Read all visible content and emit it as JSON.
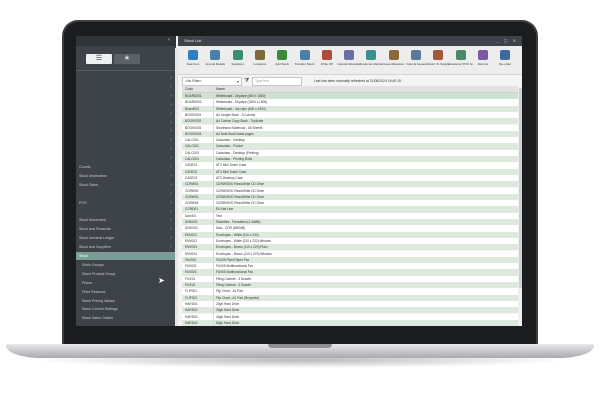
{
  "window": {
    "title": "Stock List",
    "controls": "_ ▢ ✕"
  },
  "sidebar": {
    "tabs": [
      {
        "icon": "list-icon"
      },
      {
        "icon": "star-icon"
      }
    ],
    "items": [
      {
        "label": "",
        "sub": false
      },
      {
        "label": "",
        "sub": false
      },
      {
        "label": "",
        "sub": false
      },
      {
        "label": "",
        "sub": false
      },
      {
        "label": "",
        "sub": false
      },
      {
        "label": "",
        "sub": false
      },
      {
        "label": "",
        "sub": false
      },
      {
        "label": "",
        "sub": false
      },
      {
        "label": "",
        "sub": false
      },
      {
        "label": "",
        "sub": false
      },
      {
        "label": "Counts",
        "sub": false
      },
      {
        "label": "Stock Information",
        "sub": false
      },
      {
        "label": "Stock Sales",
        "sub": false
      },
      {
        "label": "",
        "sub": false
      },
      {
        "label": "POS",
        "sub": false
      },
      {
        "label": "",
        "sub": false
      },
      {
        "label": "Stock Movement",
        "sub": false
      },
      {
        "label": "Stock and Financial",
        "sub": false
      },
      {
        "label": "Stock Nominal Ledger",
        "sub": false
      },
      {
        "label": "Stock and Suppliers",
        "sub": false
      },
      {
        "label": "Stock",
        "sub": false,
        "active": true
      },
      {
        "label": "Stock Groups",
        "sub": true
      },
      {
        "label": "Stock Product Group",
        "sub": true
      },
      {
        "label": "Prices",
        "sub": true
      },
      {
        "label": "Price Reasons",
        "sub": true
      },
      {
        "label": "Stock Pricing Values",
        "sub": true
      },
      {
        "label": "Stock Control Settings",
        "sub": true
      },
      {
        "label": "Stock Sales Orders",
        "sub": true
      }
    ]
  },
  "toolbar": {
    "buttons": [
      {
        "label": "New Item",
        "icon": "new-item-icon",
        "color": "#2d7fc1"
      },
      {
        "label": "Amend Details",
        "icon": "amend-icon",
        "color": "#4a7fa8"
      },
      {
        "label": "Suppliers",
        "icon": "suppliers-icon",
        "color": "#3a8f6d"
      },
      {
        "label": "Locations",
        "icon": "locations-icon",
        "color": "#7a6a3a"
      },
      {
        "label": "Add Stock",
        "icon": "add-stock-icon",
        "color": "#3c8a3c"
      },
      {
        "label": "Transfer Stock",
        "icon": "transfer-icon",
        "color": "#4a7fa8"
      },
      {
        "label": "Write Off",
        "icon": "write-off-icon",
        "color": "#b04a3a"
      },
      {
        "label": "Internal Allocation",
        "icon": "allocation-icon",
        "color": "#6b6fa8"
      },
      {
        "label": "Customer Allocation",
        "icon": "customer-allocation-icon",
        "color": "#3a8f8f"
      },
      {
        "label": "Issue Allocation",
        "icon": "issue-allocation-icon",
        "color": "#8a6a3a"
      },
      {
        "label": "Internal Issues",
        "icon": "internal-issues-icon",
        "color": "#5a7a9a"
      },
      {
        "label": "Return To Supplier",
        "icon": "return-icon",
        "color": "#a05a3a"
      },
      {
        "label": "Customer POO Issues",
        "icon": "poo-issues-icon",
        "color": "#4a8a6a"
      },
      {
        "label": "Returns",
        "icon": "returns-icon",
        "color": "#7a5aa0"
      },
      {
        "label": "Re-order",
        "icon": "reorder-icon",
        "color": "#3a6aa0"
      }
    ]
  },
  "filter": {
    "selected": "<No Filter>",
    "search_placeholder": "Type text",
    "refresh_text": "Last has been manually refreshed at 21/08/2024 16:40:15"
  },
  "table": {
    "columns": [
      "Code",
      "Name"
    ],
    "rows": [
      {
        "code": "BOARD001",
        "name": "Whiteboard - Drywipe (600 x 1800)"
      },
      {
        "code": "BOARD002",
        "name": "Whiteboard - Drywipe (1500 x 1800)"
      },
      {
        "code": "Board003",
        "name": "Whiteboard - dry wipe (600 x 1500)"
      },
      {
        "code": "BOOK0001",
        "name": "A4 Ledger Book - 5 Column"
      },
      {
        "code": "BOOK0002",
        "name": "A4 Carbon Copy Book - Triplicate"
      },
      {
        "code": "BOOK0003",
        "name": "Shorthand Notebook - 80 Sheets"
      },
      {
        "code": "BOOK0004",
        "name": "A4 Note Book blank pages"
      },
      {
        "code": "CALC001",
        "name": "Calculator - Desktop"
      },
      {
        "code": "CALC002",
        "name": "Calculator - Pocket"
      },
      {
        "code": "CALC003",
        "name": "Calculator - Desktop (Printing)"
      },
      {
        "code": "CALC004",
        "name": "Calculator - Printing Rolls"
      },
      {
        "code": "CASE01",
        "name": "ATX Mini Tower Case"
      },
      {
        "code": "CASE02",
        "name": "ATX Mini Tower Case"
      },
      {
        "code": "CASE03",
        "name": "ATX Desktop Case"
      },
      {
        "code": "CDRW01",
        "name": "CDRW/DVD Read/Write CD Drive"
      },
      {
        "code": "CDRW02",
        "name": "CDRW/DVD Read/Write CD Drive"
      },
      {
        "code": "CDRW03",
        "name": "CDRW/DVD Read/Write CD Drive"
      },
      {
        "code": "CDRW04",
        "name": "CDRW/DVD Read/Write CD Drive"
      },
      {
        "code": "CORD01",
        "name": "EU Net Line"
      },
      {
        "code": "Dan401",
        "name": "Test"
      },
      {
        "code": "DISK001",
        "name": "Diskettes - Formatted (1.44MB)"
      },
      {
        "code": "DISK002",
        "name": "Disk - CDR (650MB)"
      },
      {
        "code": "ENV001",
        "name": "Envelopes - White (110 x 220)"
      },
      {
        "code": "ENV002",
        "name": "Envelopes - White (110 x 220) Window"
      },
      {
        "code": "ENV003",
        "name": "Envelopes - Brown (110 x 220) Plain"
      },
      {
        "code": "ENV004",
        "name": "Envelopes - Brown (110 x 220) Window"
      },
      {
        "code": "FAX001",
        "name": "FAX05 Plain Paper Fax"
      },
      {
        "code": "FAX002",
        "name": "FAX05 Multifunctional Fax"
      },
      {
        "code": "FAX003",
        "name": "FAX05 Multifunctional Fax"
      },
      {
        "code": "FILE01",
        "name": "Filing Cabinet - 3 Drawer"
      },
      {
        "code": "FILE02",
        "name": "Filing Cabinet - 4 Drawer"
      },
      {
        "code": "FLIP001",
        "name": "Flip Chart - A1 Pad"
      },
      {
        "code": "FLIP002",
        "name": "Flip Chart - A1 Pad (Recycled)"
      },
      {
        "code": "HARD01",
        "name": "20gb Hard Drive"
      },
      {
        "code": "HARD02",
        "name": "30gb Hard Drive"
      },
      {
        "code": "HARD03",
        "name": "40gb Hard Drive"
      },
      {
        "code": "HARD04",
        "name": "60gb Hard Drive"
      }
    ]
  }
}
